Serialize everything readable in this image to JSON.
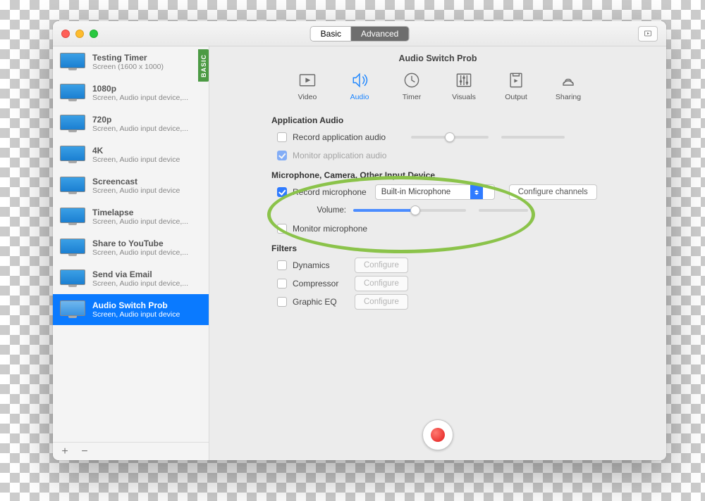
{
  "titlebar": {
    "seg_basic": "Basic",
    "seg_advanced": "Advanced"
  },
  "sidebar": {
    "basic_tag": "BASIC",
    "items": [
      {
        "name": "Testing Timer",
        "sub": "Screen (1600 x 1000)"
      },
      {
        "name": "1080p",
        "sub": "Screen, Audio input device,..."
      },
      {
        "name": "720p",
        "sub": "Screen, Audio input device,..."
      },
      {
        "name": "4K",
        "sub": "Screen, Audio input device"
      },
      {
        "name": "Screencast",
        "sub": "Screen, Audio input device"
      },
      {
        "name": "Timelapse",
        "sub": "Screen, Audio input device,..."
      },
      {
        "name": "Share to YouTube",
        "sub": "Screen, Audio input device,..."
      },
      {
        "name": "Send via Email",
        "sub": "Screen, Audio input device,..."
      },
      {
        "name": "Audio Switch Prob",
        "sub": "Screen, Audio input device"
      }
    ],
    "footer_add": "+",
    "footer_remove": "−"
  },
  "content": {
    "title": "Audio Switch Prob",
    "tabs": [
      {
        "label": "Video"
      },
      {
        "label": "Audio"
      },
      {
        "label": "Timer"
      },
      {
        "label": "Visuals"
      },
      {
        "label": "Output"
      },
      {
        "label": "Sharing"
      }
    ],
    "app_audio": {
      "heading": "Application Audio",
      "record": "Record application audio",
      "monitor": "Monitor application audio"
    },
    "mic": {
      "heading": "Microphone, Camera, Other Input Device",
      "record": "Record microphone",
      "device": "Built-in Microphone",
      "configure": "Configure channels",
      "volume_label": "Volume:",
      "monitor": "Monitor microphone"
    },
    "filters": {
      "heading": "Filters",
      "items": [
        {
          "name": "Dynamics",
          "btn": "Configure"
        },
        {
          "name": "Compressor",
          "btn": "Configure"
        },
        {
          "name": "Graphic EQ",
          "btn": "Configure"
        }
      ]
    }
  }
}
